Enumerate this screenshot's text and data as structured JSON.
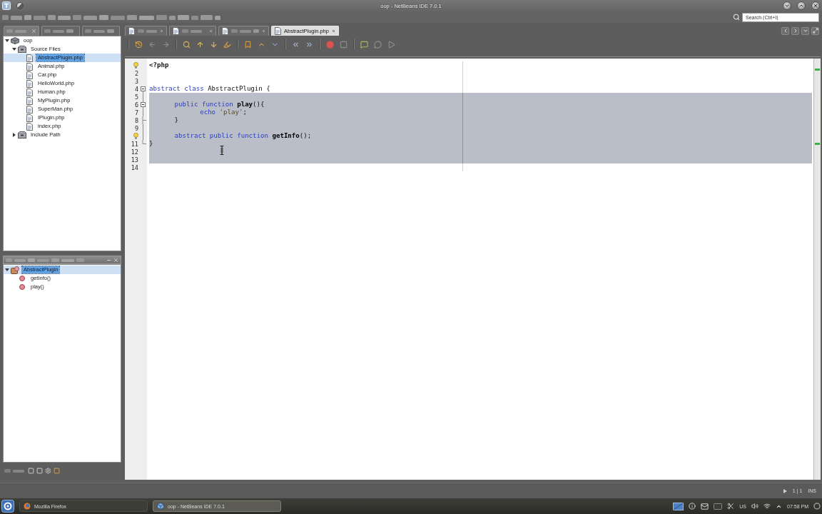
{
  "window": {
    "title": "oop - NetBeans IDE 7.0.1"
  },
  "search": {
    "placeholder": "Search (Ctrl+I)"
  },
  "explorer_tabs": [
    {
      "selected": true,
      "closable": true
    },
    {
      "selected": false,
      "closable": false
    },
    {
      "selected": false,
      "closable": false
    }
  ],
  "project_tree": [
    {
      "label": "oop",
      "kind": "project",
      "expanded": true,
      "selected": false,
      "children": [
        {
          "label": "Source Files",
          "kind": "folder",
          "expanded": true,
          "selected": false,
          "children": [
            {
              "label": "AbstractPlugin.php",
              "kind": "file",
              "selected": true
            },
            {
              "label": "Animal.php",
              "kind": "file",
              "selected": false
            },
            {
              "label": "Car.php",
              "kind": "file",
              "selected": false
            },
            {
              "label": "HelloWorld.php",
              "kind": "file",
              "selected": false
            },
            {
              "label": "Human.php",
              "kind": "file",
              "selected": false
            },
            {
              "label": "MyPlugin.php",
              "kind": "file",
              "selected": false
            },
            {
              "label": "SuperMan.php",
              "kind": "file",
              "selected": false
            },
            {
              "label": "IPlugin.php",
              "kind": "file",
              "selected": false
            },
            {
              "label": "index.php",
              "kind": "file",
              "selected": false
            }
          ]
        },
        {
          "label": "Include Path",
          "kind": "folder",
          "expanded": false,
          "selected": false
        }
      ]
    }
  ],
  "navigator": {
    "tree": [
      {
        "label": "AbstractPlugin",
        "kind": "class",
        "expanded": true,
        "selected": true,
        "children": [
          {
            "label": "getInfo()",
            "kind": "method",
            "selected": false
          },
          {
            "label": "play()",
            "kind": "method",
            "selected": false
          }
        ]
      }
    ]
  },
  "editor_tabs": [
    {
      "selected": false
    },
    {
      "selected": false
    },
    {
      "selected": false
    },
    {
      "label": "AbstractPlugin.php",
      "selected": true
    }
  ],
  "editor": {
    "lines": [
      {
        "hint": true,
        "fold_start": false,
        "fold_end": false,
        "selected": false,
        "tokens": [
          {
            "text": "<?php",
            "kind": "tag"
          }
        ]
      },
      {
        "number": "2",
        "hint": false,
        "fold_start": false,
        "fold_end": false,
        "selected": false
      },
      {
        "number": "3",
        "hint": false,
        "fold_start": false,
        "fold_end": false,
        "selected": false
      },
      {
        "number": "4",
        "hint": false,
        "fold_start": true,
        "fold_end": false,
        "selected": false,
        "tokens": [
          {
            "text": "abstract class",
            "kind": "keyword"
          },
          {
            "text": " AbstractPlugin {",
            "kind": "plain"
          }
        ]
      },
      {
        "number": "5",
        "hint": false,
        "fold_start": false,
        "fold_end": false,
        "selected": true
      },
      {
        "number": "6",
        "hint": false,
        "fold_start": true,
        "fold_end": false,
        "selected": true,
        "tokens": [
          {
            "text": "public function",
            "kind": "keyword"
          },
          {
            "text": " play",
            "kind": "name"
          },
          {
            "text": "(){",
            "kind": "plain"
          }
        ]
      },
      {
        "number": "7",
        "hint": false,
        "fold_start": false,
        "fold_end": false,
        "selected": true,
        "tokens": [
          {
            "text": "echo",
            "kind": "keyword"
          },
          {
            "text": " 'play'",
            "kind": "string"
          },
          {
            "text": ";",
            "kind": "plain"
          }
        ]
      },
      {
        "number": "8",
        "hint": false,
        "fold_start": false,
        "fold_end": true,
        "selected": true,
        "tokens": [
          {
            "text": "}",
            "kind": "plain"
          }
        ]
      },
      {
        "number": "9",
        "hint": false,
        "fold_start": false,
        "fold_end": false,
        "selected": true
      },
      {
        "hint": true,
        "fold_start": false,
        "fold_end": false,
        "selected": true,
        "tokens": [
          {
            "text": "abstract public function",
            "kind": "keyword"
          },
          {
            "text": " getInfo",
            "kind": "name"
          },
          {
            "text": "();",
            "kind": "plain"
          }
        ]
      },
      {
        "number": "11",
        "hint": false,
        "fold_start": false,
        "fold_end": true,
        "selected": true,
        "tokens": [
          {
            "text": "}",
            "kind": "plain"
          }
        ]
      },
      {
        "number": "12",
        "hint": false,
        "fold_start": false,
        "fold_end": false,
        "selected": true
      },
      {
        "number": "13",
        "hint": false,
        "fold_start": false,
        "fold_end": false,
        "selected": true
      },
      {
        "number": "14",
        "hint": false,
        "fold_start": false,
        "fold_end": false,
        "selected": false
      }
    ]
  },
  "status_bar": {
    "position": "1 | 1",
    "mode": "INS"
  },
  "taskbar": {
    "tasks": [
      {
        "label": "Mozilla Firefox",
        "kind": "browser",
        "selected": false
      },
      {
        "label": "oop - NetBeans IDE 7.0.1",
        "kind": "ide",
        "selected": true
      }
    ],
    "keyboard_layout": "US",
    "clock": "07:58 PM"
  }
}
